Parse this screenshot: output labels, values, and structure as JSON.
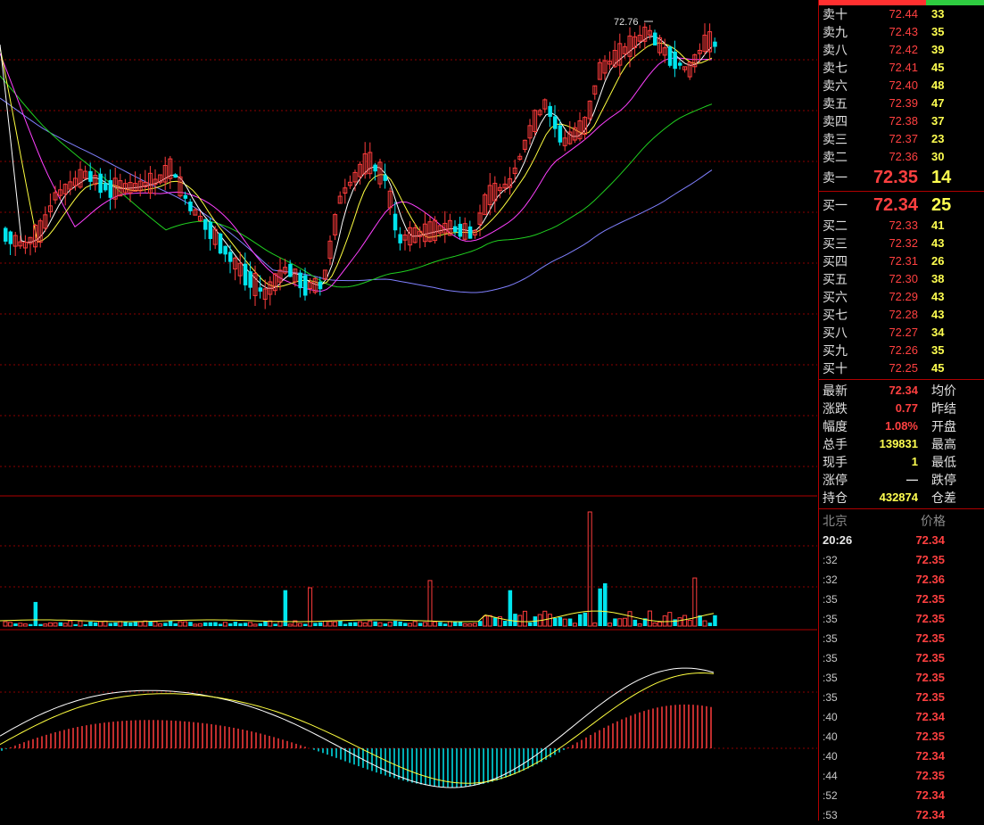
{
  "chart": {
    "high_label": "72.76",
    "colors": {
      "up": "#ff3c3c",
      "down": "#00e5ee",
      "ma1": "#ffffff",
      "ma2": "#ffff40",
      "ma3": "#ff40ff",
      "ma4": "#20d020",
      "ma5": "#8080ff",
      "grid": "#8b0000"
    }
  },
  "order_book": {
    "asks": [
      {
        "label": "卖十",
        "price": "72.44",
        "vol": "33"
      },
      {
        "label": "卖九",
        "price": "72.43",
        "vol": "35"
      },
      {
        "label": "卖八",
        "price": "72.42",
        "vol": "39"
      },
      {
        "label": "卖七",
        "price": "72.41",
        "vol": "45"
      },
      {
        "label": "卖六",
        "price": "72.40",
        "vol": "48"
      },
      {
        "label": "卖五",
        "price": "72.39",
        "vol": "47"
      },
      {
        "label": "卖四",
        "price": "72.38",
        "vol": "37"
      },
      {
        "label": "卖三",
        "price": "72.37",
        "vol": "23"
      },
      {
        "label": "卖二",
        "price": "72.36",
        "vol": "30"
      },
      {
        "label": "卖一",
        "price": "72.35",
        "vol": "14"
      }
    ],
    "bids": [
      {
        "label": "买一",
        "price": "72.34",
        "vol": "25"
      },
      {
        "label": "买二",
        "price": "72.33",
        "vol": "41"
      },
      {
        "label": "买三",
        "price": "72.32",
        "vol": "43"
      },
      {
        "label": "买四",
        "price": "72.31",
        "vol": "26"
      },
      {
        "label": "买五",
        "price": "72.30",
        "vol": "38"
      },
      {
        "label": "买六",
        "price": "72.29",
        "vol": "43"
      },
      {
        "label": "买七",
        "price": "72.28",
        "vol": "43"
      },
      {
        "label": "买八",
        "price": "72.27",
        "vol": "34"
      },
      {
        "label": "买九",
        "price": "72.26",
        "vol": "35"
      },
      {
        "label": "买十",
        "price": "72.25",
        "vol": "45"
      }
    ]
  },
  "quote": [
    {
      "label": "最新",
      "value": "72.34",
      "color": "red",
      "label2": "均价"
    },
    {
      "label": "涨跌",
      "value": "0.77",
      "color": "red",
      "label2": "昨结"
    },
    {
      "label": "幅度",
      "value": "1.08%",
      "color": "red",
      "label2": "开盘"
    },
    {
      "label": "总手",
      "value": "139831",
      "color": "yellow",
      "label2": "最高"
    },
    {
      "label": "现手",
      "value": "1",
      "color": "yellow",
      "label2": "最低"
    },
    {
      "label": "涨停",
      "value": "—",
      "color": "white",
      "label2": "跌停"
    },
    {
      "label": "持仓",
      "value": "432874",
      "color": "yellow",
      "label2": "仓差"
    }
  ],
  "ticks": {
    "header_left": "北京",
    "header_right": "价格",
    "rows": [
      {
        "time": "20:26",
        "price": "72.34"
      },
      {
        "time": ":32",
        "price": "72.35"
      },
      {
        "time": ":32",
        "price": "72.36"
      },
      {
        "time": ":35",
        "price": "72.35"
      },
      {
        "time": ":35",
        "price": "72.35"
      },
      {
        "time": ":35",
        "price": "72.35"
      },
      {
        "time": ":35",
        "price": "72.35"
      },
      {
        "time": ":35",
        "price": "72.35"
      },
      {
        "time": ":35",
        "price": "72.35"
      },
      {
        "time": ":40",
        "price": "72.34"
      },
      {
        "time": ":40",
        "price": "72.35"
      },
      {
        "time": ":40",
        "price": "72.34"
      },
      {
        "time": ":44",
        "price": "72.35"
      },
      {
        "time": ":52",
        "price": "72.34"
      },
      {
        "time": ":53",
        "price": "72.34"
      }
    ]
  }
}
